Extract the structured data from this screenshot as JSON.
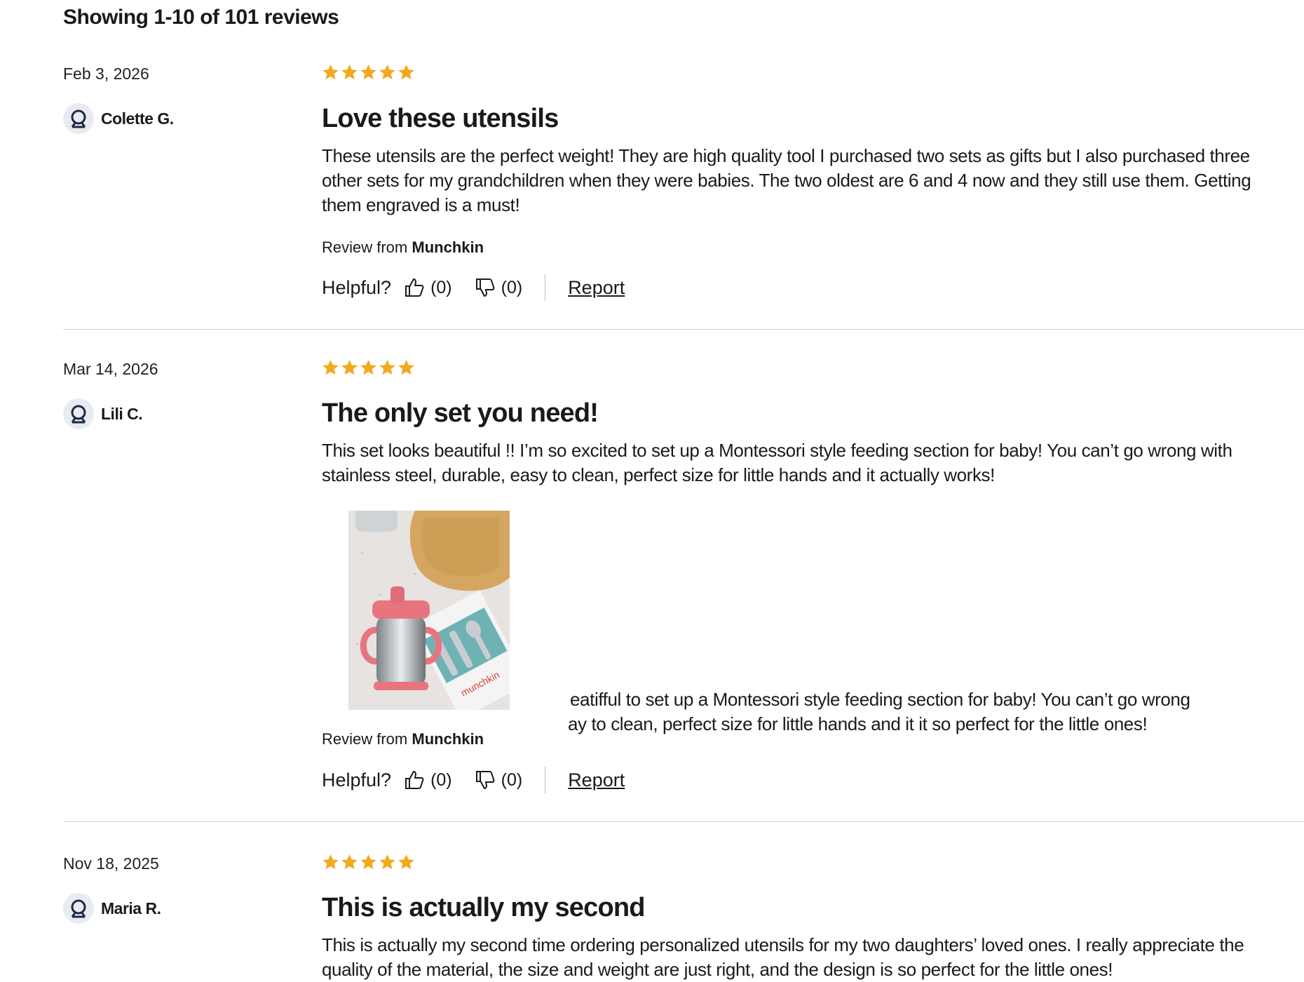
{
  "summary": "Showing 1-10 of 101 reviews",
  "colors": {
    "star": "#f2a91d",
    "divider": "#cfcfcf",
    "avatar_bg": "#e8ebf0",
    "icon": "#1f2a44"
  },
  "reviews": [
    {
      "date": "Feb 3, 2026",
      "author": "Colette G.",
      "rating": 5,
      "title": "Love these utensils",
      "body": "These utensils are the perfect weight! They are high quality tool I purchased two sets as gifts but I also purchased three other sets for my grandchildren when they were babies. The two oldest are 6 and 4 now and they still use them. Getting them engraved is a must!",
      "source_prefix": "Review from",
      "source_brand": "Munchkin",
      "helpful_label": "Helpful?",
      "helpful_yes": "(0)",
      "helpful_no": "(0)",
      "report": "Report"
    },
    {
      "date": "Mar 14, 2026",
      "author": "Lili C.",
      "rating": 5,
      "title": "The only set you need!",
      "body": "This set looks beautiful !! I’m so excited to set up a Montessori style feeding section for baby! You can’t go wrong with stainless steel, durable, easy to clean, perfect size for little hands and it actually works!",
      "overlay_line_1": "eatifful to set up a Montessori style feeding section for baby! You can’t go wrong",
      "overlay_line_2": "ay to clean, perfect size for little hands and it it so perfect for the little ones!",
      "photo_brand": "munchkin",
      "source_prefix": "Review from",
      "source_brand": "Munchkin",
      "helpful_label": "Helpful?",
      "helpful_yes": "(0)",
      "helpful_no": "(0)",
      "report": "Report"
    },
    {
      "date": "Nov 18, 2025",
      "author": "Maria R.",
      "rating": 5,
      "title": "This is actually my second",
      "body": "This is actually my second time ordering personalized utensils for my two daughters’ loved ones. I really appreciate the quality of the material, the size and weight are just right, and the design is so perfect for the little ones!"
    }
  ]
}
